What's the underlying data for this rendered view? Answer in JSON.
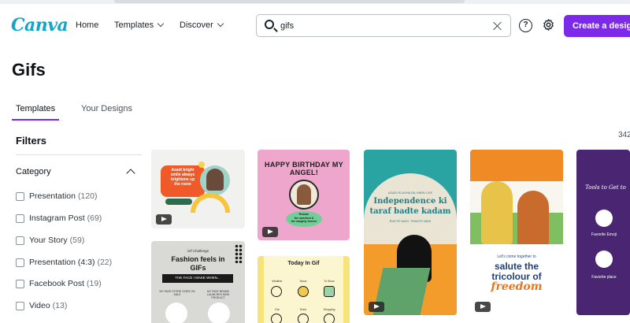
{
  "header": {
    "logo": "Canva",
    "nav": [
      {
        "label": "Home"
      },
      {
        "label": "Templates"
      },
      {
        "label": "Discover"
      }
    ],
    "search": {
      "value": "gifs",
      "placeholder": ""
    },
    "help_symbol": "?",
    "create_label": "Create a design",
    "brand_color": "#7d2ae8",
    "logo_color": "#13a5c8"
  },
  "page": {
    "title": "Gifs",
    "tabs": [
      {
        "label": "Templates",
        "active": true
      },
      {
        "label": "Your Designs",
        "active": false
      }
    ],
    "result_count": "342"
  },
  "filters": {
    "title": "Filters",
    "category_label": "Category",
    "categories": [
      {
        "label": "Presentation",
        "count": "(120)"
      },
      {
        "label": "Instagram Post",
        "count": "(69)"
      },
      {
        "label": "Your Story",
        "count": "(59)"
      },
      {
        "label": "Presentation (4:3)",
        "count": "(22)"
      },
      {
        "label": "Facebook Post",
        "count": "(19)"
      },
      {
        "label": "Video",
        "count": "(13)"
      }
    ]
  },
  "templates": {
    "t1": {
      "lines": [
        "Azadi bright",
        "smile always",
        "brightens up",
        "the room"
      ]
    },
    "t2": {
      "title": "HAPPY BIRTHDAY MY ANGEL!",
      "sub": "Remain",
      "sub2": "the sweetest &",
      "sub3": "the naughty forever"
    },
    "t3": {
      "tag": "AZADI KI ASHA DIL MEIN LIYE",
      "title": "Independence ki",
      "title2": "taraf badte kadam",
      "sub": "RUKTE NAHI, THAKTE NAHI"
    },
    "t4": {
      "small": "Let's come together to",
      "title": "salute the",
      "title2": "tricolour of",
      "title3": "freedom"
    },
    "t5": {
      "title": "Tools to Get to",
      "items": [
        "Favorite Emoji",
        "Favorite place"
      ]
    },
    "t6": {
      "eyebrow": "Gif Challenge",
      "title": "Fashion feels in",
      "title2": "GIFs",
      "bar": "THE FACE I MAKE WHEN...",
      "left": "MY FAVE STORE GOES ON SALE",
      "right": "MY FAVE BRAND LAUNCHES NEW PRODUCT"
    },
    "t7": {
      "title": "Today In Gif",
      "cols": [
        "Weather",
        "Mood",
        "To Show"
      ],
      "cols2": [
        "Eat",
        "Drink",
        "Shopping"
      ]
    }
  }
}
